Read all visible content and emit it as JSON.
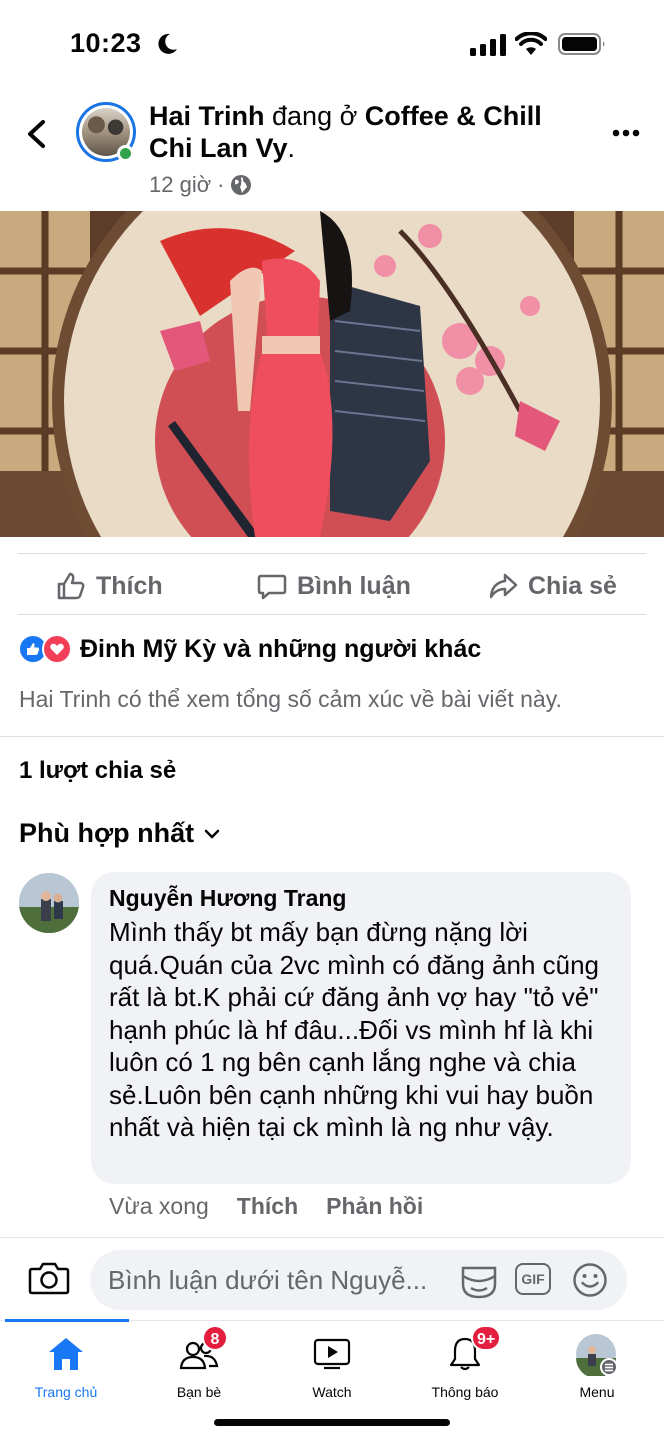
{
  "status_bar": {
    "time": "10:23"
  },
  "post": {
    "author": "Hai Trinh",
    "verb": " đang ở ",
    "place": "Coffee & Chill Chi Lan Vy",
    "place_end": ".",
    "time": "12 giờ",
    "dot": "·",
    "audience_icon": "globe-icon"
  },
  "actions": {
    "like": "Thích",
    "comment": "Bình luận",
    "share": "Chia sẻ"
  },
  "reactions": {
    "text": "Đinh Mỹ Kỳ và những người khác",
    "note": "Hai Trinh có thể xem tổng số cảm xúc về bài viết này.",
    "like_color": "#1877f2",
    "love_color": "#f33e58"
  },
  "shares": "1 lượt chia sẻ",
  "sort_label": "Phù hợp nhất",
  "comment": {
    "name": "Nguyễn Hương Trang",
    "text": "Mình thấy bt mấy bạn đừng nặng lời quá.Quán của 2vc mình có đăng ảnh cũng rất là bt.K phải cứ đăng ảnh vợ hay \"tỏ vẻ\" hạnh phúc là hf đâu...Đối vs mình hf là khi luôn có 1 ng bên cạnh lắng nghe và chia sẻ.Luôn bên cạnh những khi vui hay buồn nhất và hiện tại ck mình là ng như vậy.",
    "time": "Vừa xong",
    "like": "Thích",
    "reply": "Phản hồi"
  },
  "comment_input": {
    "placeholder": "Bình luận dưới tên Nguyễ...",
    "gif": "GIF"
  },
  "tabs": [
    {
      "label": "Trang chủ",
      "icon": "home-icon",
      "active": true
    },
    {
      "label": "Bạn bè",
      "icon": "friends-icon",
      "badge": "8"
    },
    {
      "label": "Watch",
      "icon": "watch-icon"
    },
    {
      "label": "Thông báo",
      "icon": "bell-icon",
      "badge": "9+"
    },
    {
      "label": "Menu",
      "icon": "profile-menu-icon"
    }
  ],
  "accent": "#1877f2"
}
